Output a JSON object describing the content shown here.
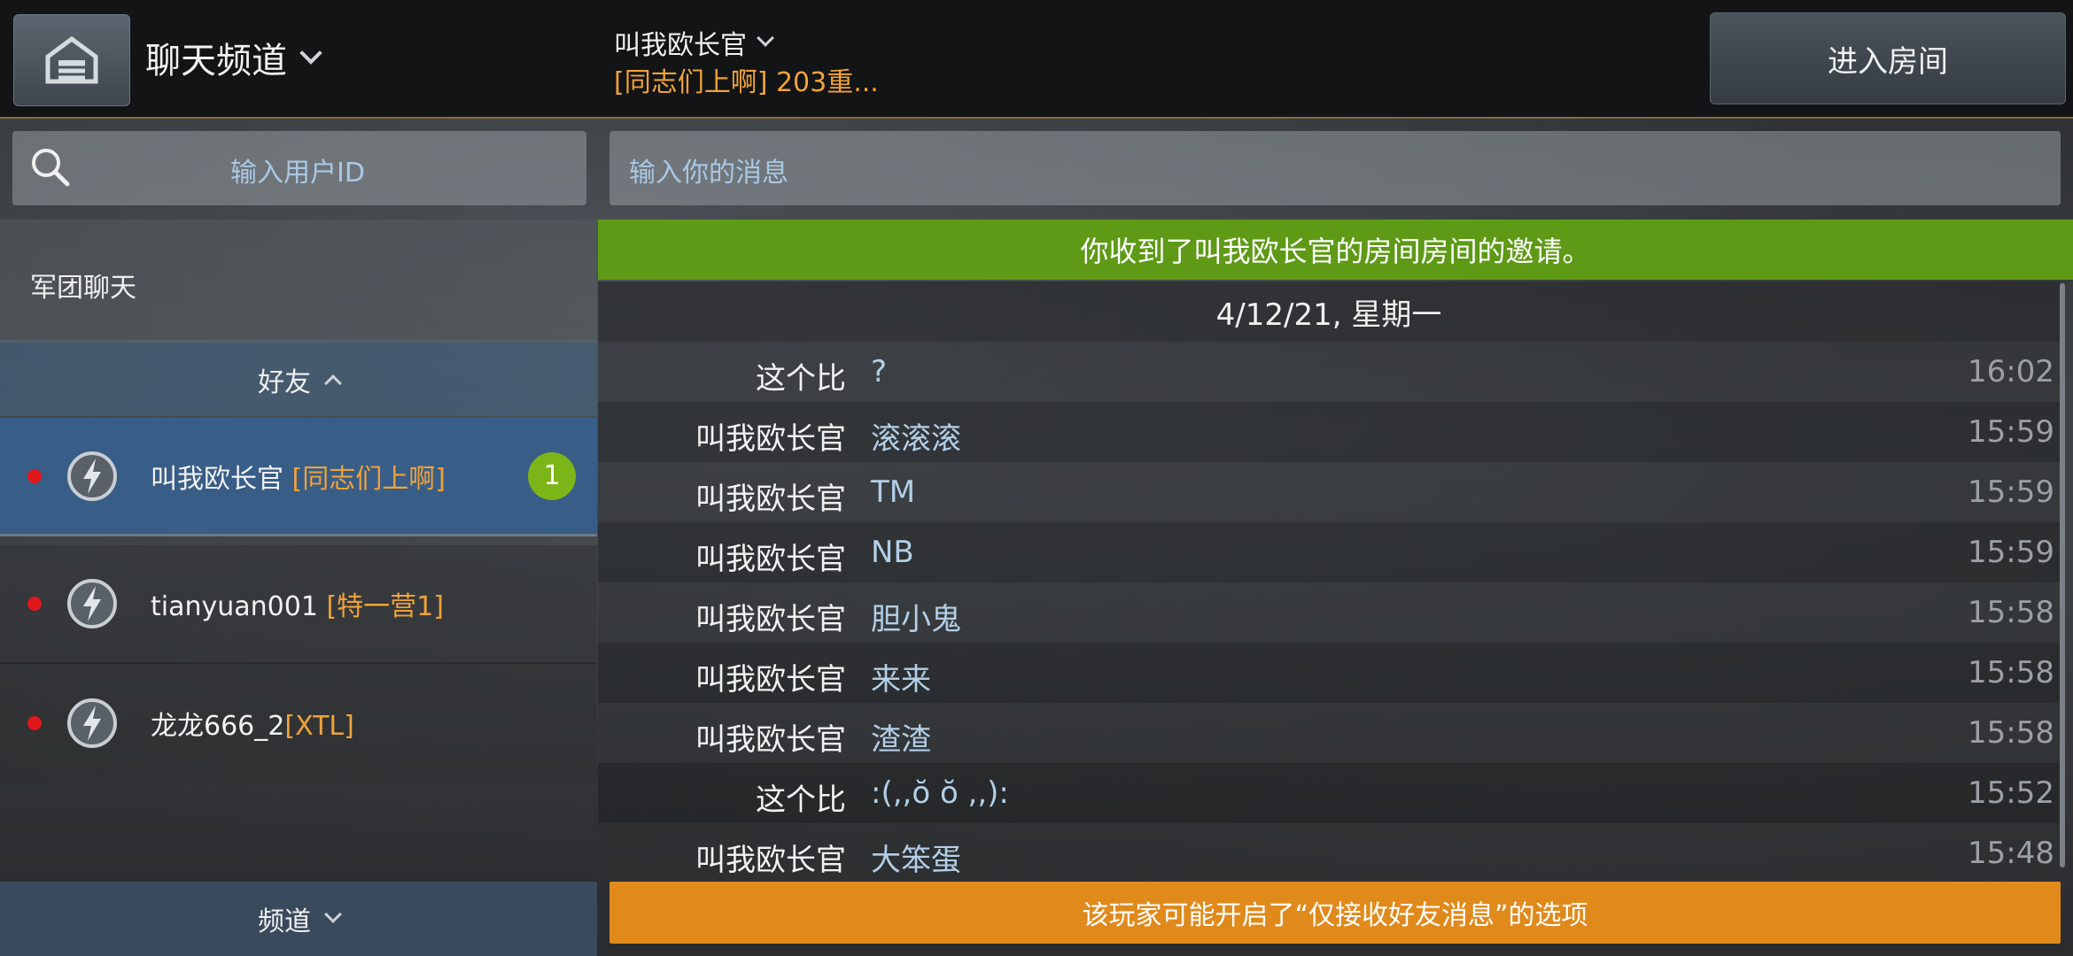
{
  "header": {
    "title": "聊天频道",
    "chat_user": "叫我欧长官",
    "chat_subtitle": "[同志们上啊] 203重...",
    "enter_room_label": "进入房间"
  },
  "sidebar": {
    "user_search_placeholder": "输入用户ID",
    "legion_chat_label": "军团聊天",
    "friends_label": "好友",
    "channels_label": "频道",
    "friends": [
      {
        "name": "叫我欧长官",
        "tag": "[同志们上啊]",
        "unread": "1",
        "online_status": "offline"
      },
      {
        "name": "tianyuan001",
        "tag": "[特一营1]",
        "online_status": "offline"
      },
      {
        "name": "龙龙666_2",
        "tag": "[XTL]",
        "online_status": "offline"
      }
    ]
  },
  "chat": {
    "message_placeholder": "输入你的消息",
    "invite_banner": "你收到了叫我欧长官的房间房间的邀请。",
    "date": "4/12/21, 星期一",
    "messages": [
      {
        "sender": "这个比",
        "text": "?",
        "time": "16:02"
      },
      {
        "sender": "叫我欧长官",
        "text": "滚滚滚",
        "time": "15:59"
      },
      {
        "sender": "叫我欧长官",
        "text": "TM",
        "time": "15:59"
      },
      {
        "sender": "叫我欧长官",
        "text": "NB",
        "time": "15:59"
      },
      {
        "sender": "叫我欧长官",
        "text": "胆小鬼",
        "time": "15:58"
      },
      {
        "sender": "叫我欧长官",
        "text": "来来",
        "time": "15:58"
      },
      {
        "sender": "叫我欧长官",
        "text": "渣渣",
        "time": "15:58"
      },
      {
        "sender": "这个比",
        "text": ":(,,ŏ ŏ ,,):",
        "time": "15:52"
      },
      {
        "sender": "叫我欧长官",
        "text": "大笨蛋",
        "time": "15:48"
      }
    ],
    "warning": "该玩家可能开启了“仅接收好友消息”的选项"
  },
  "colors": {
    "accent_orange": "#f0a23a",
    "invite_green": "#5e9a16",
    "warning_orange": "#e08a1c",
    "unread_badge": "#7cb518",
    "status_dot": "#e0181b"
  }
}
